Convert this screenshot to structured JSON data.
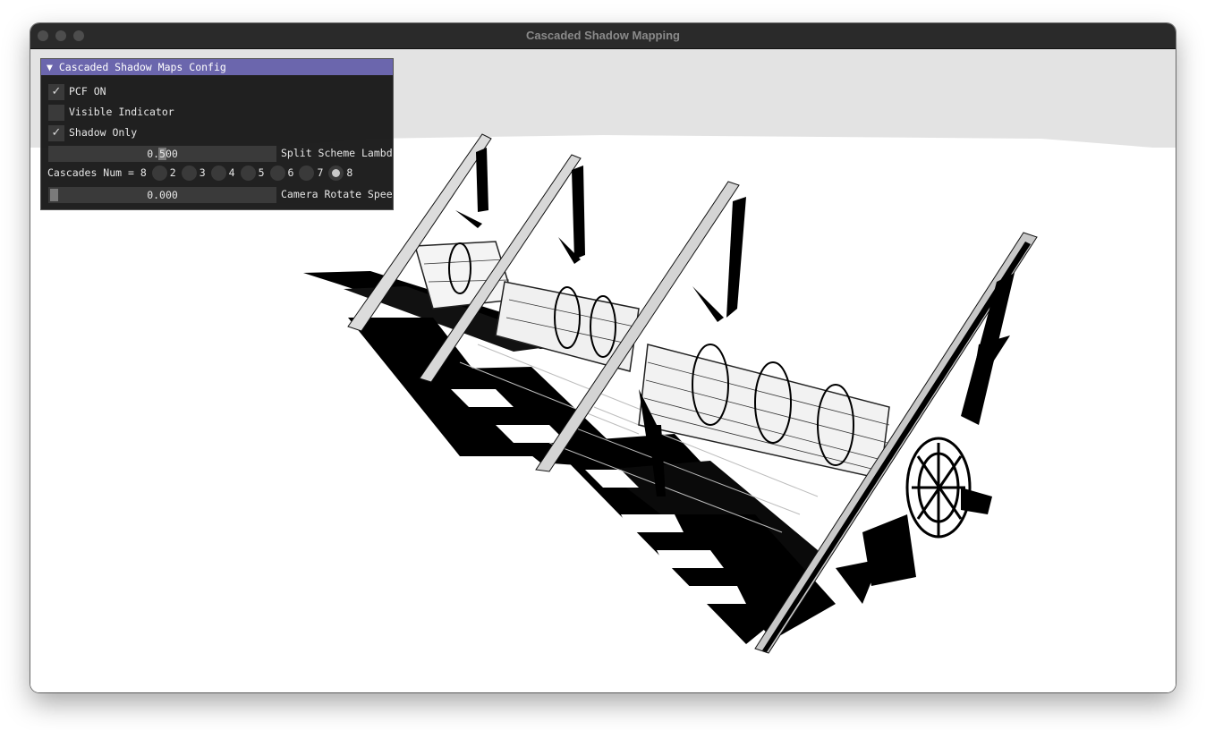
{
  "window": {
    "title": "Cascaded Shadow Mapping"
  },
  "panel": {
    "header_arrow": "▼",
    "title": "Cascaded Shadow Maps Config",
    "checkboxes": [
      {
        "label": "PCF ON",
        "checked": true
      },
      {
        "label": "Visible Indicator",
        "checked": false
      },
      {
        "label": "Shadow Only",
        "checked": true
      }
    ],
    "split_slider": {
      "value": "0.500",
      "label": "Split Scheme Lambda",
      "fraction": 0.5
    },
    "cascades": {
      "label": "Cascades Num = 8",
      "options": [
        "2",
        "3",
        "4",
        "5",
        "6",
        "7",
        "8"
      ],
      "selected": "8"
    },
    "rotate_slider": {
      "value": "0.000",
      "label": "Camera Rotate Speed",
      "fraction": 0.0
    }
  },
  "colors": {
    "header_bg": "#6b66ad",
    "panel_bg": "#181818",
    "sky": "#e3e3e3",
    "ground": "#ffffff",
    "shadow": "#000000"
  }
}
